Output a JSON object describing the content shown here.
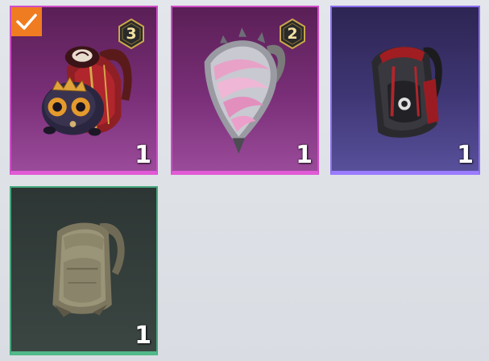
{
  "inventory": {
    "items": [
      {
        "name": "backpack-red-mascot",
        "quantity": "1",
        "level": "3",
        "selected": true,
        "rarity_color": "#d04ec8",
        "icon": "mascot-backpack-icon"
      },
      {
        "name": "backpack-pink-shell",
        "quantity": "1",
        "level": "2",
        "selected": false,
        "rarity_color": "#d04ec8",
        "icon": "shell-backpack-icon"
      },
      {
        "name": "backpack-black-red",
        "quantity": "1",
        "selected": false,
        "rarity_color": "#8b6cf0",
        "icon": "black-backpack-icon"
      },
      {
        "name": "backpack-khaki",
        "quantity": "1",
        "selected": false,
        "rarity_color": "#47a77d",
        "icon": "khaki-backpack-icon"
      }
    ],
    "selected_color": "#f07c22"
  }
}
